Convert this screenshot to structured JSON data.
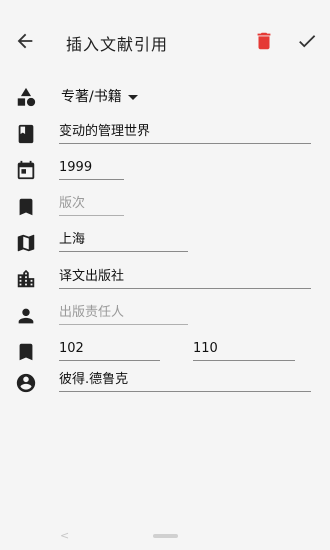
{
  "appbar": {
    "title": "插入文献引用"
  },
  "form": {
    "type_selected": "专著/书籍",
    "title_value": "变动的管理世界",
    "year_value": "1999",
    "edition_placeholder": "版次",
    "place_value": "上海",
    "publisher_value": "译文出版社",
    "responsible_placeholder": "出版责任人",
    "page_start_value": "102",
    "page_end_value": "110",
    "author_value": "彼得.德鲁克"
  },
  "colors": {
    "accent": "#e53935",
    "text": "#212121",
    "placeholder": "#9a9a9a",
    "background": "#f5f5f5"
  },
  "icons": {
    "back": "arrow-back-icon",
    "delete": "trash-icon",
    "confirm": "check-icon",
    "type": "category-shapes-icon",
    "title": "book-icon",
    "year": "calendar-icon",
    "edition": "bookmark-icon",
    "place": "map-icon",
    "publisher": "building-icon",
    "responsible": "person-icon",
    "pages": "bookmark-icon",
    "author": "account-circle-icon"
  }
}
